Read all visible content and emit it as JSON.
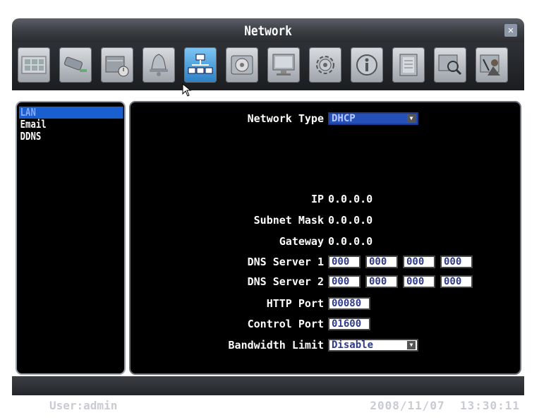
{
  "window": {
    "title": "Network"
  },
  "toolbar": {
    "icons": [
      "camera-display-icon",
      "ptz-camera-icon",
      "record-schedule-icon",
      "alarm-bell-icon",
      "network-icon",
      "disk-icon",
      "monitor-icon",
      "settings-gear-icon",
      "info-icon",
      "event-log-icon",
      "search-icon",
      "user-security-icon"
    ],
    "active_index": 4
  },
  "sidebar": {
    "items": [
      {
        "label": "LAN",
        "selected": true
      },
      {
        "label": "Email",
        "selected": false
      },
      {
        "label": "DDNS",
        "selected": false
      }
    ]
  },
  "form": {
    "network_type": {
      "label": "Network Type",
      "value": "DHCP"
    },
    "ip": {
      "label": "IP",
      "value": "0.0.0.0"
    },
    "subnet_mask": {
      "label": "Subnet Mask",
      "value": "0.0.0.0"
    },
    "gateway": {
      "label": "Gateway",
      "value": "0.0.0.0"
    },
    "dns1": {
      "label": "DNS Server 1",
      "octets": [
        "000",
        "000",
        "000",
        "000"
      ]
    },
    "dns2": {
      "label": "DNS Server 2",
      "octets": [
        "000",
        "000",
        "000",
        "000"
      ]
    },
    "http_port": {
      "label": "HTTP Port",
      "value": "00080"
    },
    "control_port": {
      "label": "Control Port",
      "value": "01600"
    },
    "bandwidth_limit": {
      "label": "Bandwidth Limit",
      "value": "Disable"
    }
  },
  "status": {
    "user": "User:admin",
    "date": "2008/11/07",
    "time": "13:30:11"
  },
  "colors": {
    "accent_blue": "#2450b8",
    "selected_item": "#1a5fd0",
    "frame": "#9aa0a8"
  }
}
